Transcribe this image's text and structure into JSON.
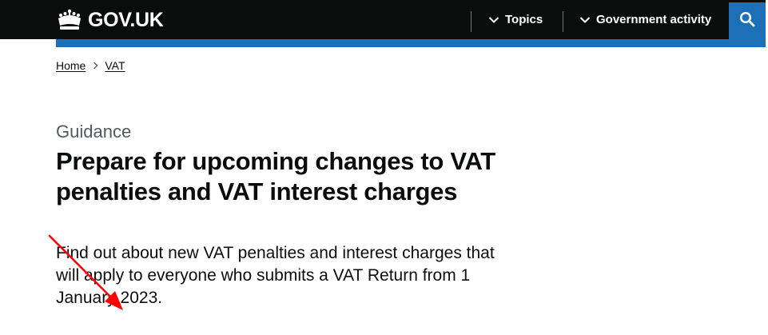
{
  "header": {
    "logo_text": "GOV.UK",
    "logo_icon": "crown-icon",
    "nav": [
      {
        "label": "Topics",
        "icon": "chevron-down-icon"
      },
      {
        "label": "Government activity",
        "icon": "chevron-down-icon"
      }
    ],
    "search_icon": "search-icon"
  },
  "breadcrumb": [
    {
      "label": "Home"
    },
    {
      "label": "VAT"
    }
  ],
  "page": {
    "caption": "Guidance",
    "title": "Prepare for upcoming changes to VAT penalties and VAT interest charges",
    "lead_lines": [
      "Find out about new VAT penalties and interest charges that",
      "will apply to everyone who submits a VAT Return from 1",
      "January 2023."
    ]
  },
  "annotation": {
    "type": "arrow",
    "color": "#ff0000"
  },
  "colors": {
    "header_bg": "#0b0c0c",
    "accent_blue": "#1d70b8",
    "caption_grey": "#505a5f",
    "text": "#0b0c0c"
  }
}
